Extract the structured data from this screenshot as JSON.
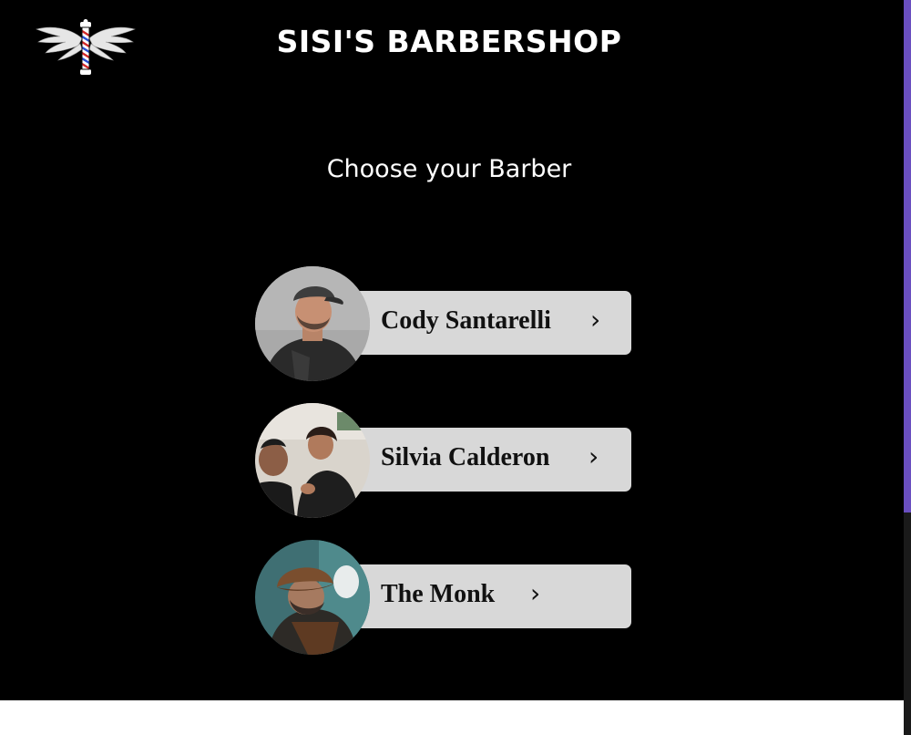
{
  "header": {
    "logo": "barber-pole-wings-logo",
    "title": "SISI'S BARBERSHOP"
  },
  "main": {
    "heading": "Choose your Barber",
    "barbers": [
      {
        "name": "Cody Santarelli",
        "chevron": "›",
        "photo": "cody-santarelli-photo"
      },
      {
        "name": "Silvia Calderon",
        "chevron": "›",
        "photo": "silvia-calderon-photo"
      },
      {
        "name": "The Monk",
        "chevron": "›",
        "photo": "the-monk-photo"
      }
    ]
  },
  "colors": {
    "background": "#000000",
    "card": "#d8d8d8",
    "text_light": "#ffffff",
    "text_dark": "#111111",
    "scrollbar_thumb": "#6a4fc0"
  }
}
